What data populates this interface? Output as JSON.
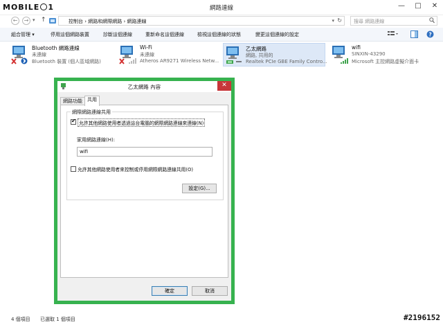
{
  "window": {
    "logo_text": "MOBILE01",
    "title": "網路連線",
    "controls": {
      "minimize": "—",
      "maximize": "□",
      "close": "✕"
    }
  },
  "nav": {
    "back": "←",
    "forward": "→",
    "down": "▾",
    "up": "↑",
    "breadcrumbs": "控制台  ›  網路和網際網路  ›  網路連線",
    "search_placeholder": "搜尋 網路連線",
    "refresh": "↻",
    "dropdown": "▾"
  },
  "toolbar": {
    "organize": "組合管理 ▾",
    "disable": "停用這個網路裝置",
    "diagnose": "診斷這個連線",
    "rename": "重新命名這個連線",
    "view_status": "檢視這個連線的狀態",
    "change_settings": "變更這個連線的設定"
  },
  "connections": [
    {
      "name": "Bluetooth 網路連線",
      "status": "未連線",
      "device": "Bluetooth 裝置 (個人區域網路)"
    },
    {
      "name": "Wi-Fi",
      "status": "未連線",
      "device": "Atheros AR9271 Wireless Netw..."
    },
    {
      "name": "乙太網路",
      "status": "網路, 共用的",
      "device": "Realtek PCIe GBE Family Contro..."
    },
    {
      "name": "wifi",
      "status": "SINXIN-43290",
      "device": "Microsoft 主控網路虛擬介面卡"
    }
  ],
  "status_bar": {
    "items": "4 個項目",
    "selected": "已選取 1 個項目",
    "watermark": "#2196152"
  },
  "dialog": {
    "title": "乙太網路 內容",
    "close": "✕",
    "tabs": [
      "網路功能",
      "共用"
    ],
    "group_label": "網際網路連線共用",
    "allow_share": "允許其他網路使用者透過這台電腦的網際網路連線來連線(N)",
    "home_label": "家用網路連線(H):",
    "home_value": "wifi",
    "allow_control": "允許其他網路使用者來控制或停用網際網路連線共用(O)",
    "settings_btn": "設定(G)...",
    "ok": "確定",
    "cancel": "取消"
  }
}
